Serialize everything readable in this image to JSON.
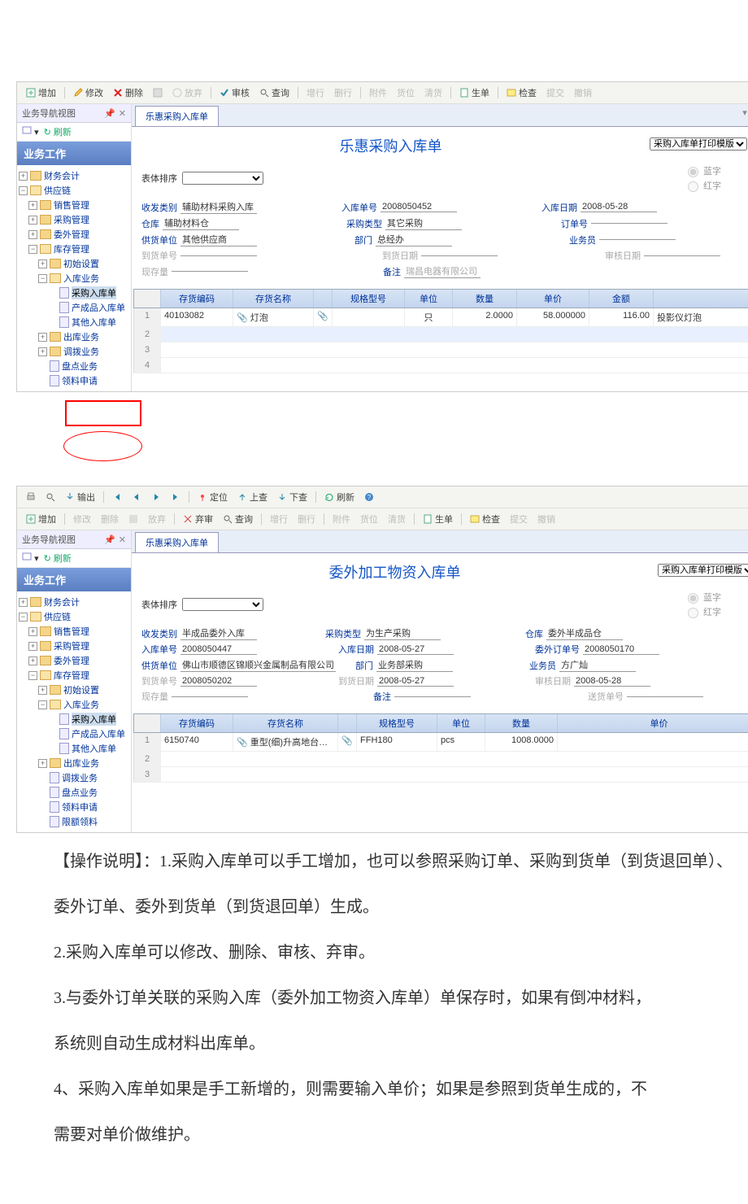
{
  "toolbar": {
    "add": "增加",
    "edit": "修改",
    "delete": "删除",
    "undo": "",
    "abandon": "放弃",
    "audit": "审核",
    "unaudit": "弃审",
    "query": "查询",
    "addrow": "增行",
    "delrow": "删行",
    "attach": "附件",
    "locate": "货位",
    "clear": "清货",
    "bill": "生单",
    "check": "检查",
    "submit": "提交",
    "revoke": "撤销",
    "output": "输出",
    "first": "",
    "prev": "",
    "next": "",
    "last": "",
    "position": "定位",
    "upquery": "上查",
    "downquery": "下查",
    "refresh": "刷新"
  },
  "sidebar": {
    "title": "业务导航视图",
    "close_x": "✕",
    "dropdown": "▾",
    "refresh": "刷新",
    "header": "业务工作",
    "nodes": {
      "n0": "财务会计",
      "n1": "供应链",
      "n2": "销售管理",
      "n3": "采购管理",
      "n4": "委外管理",
      "n5": "库存管理",
      "n6": "初始设置",
      "n7": "入库业务",
      "n8": "采购入库单",
      "n9": "产成品入库单",
      "n10": "其他入库单",
      "n11": "出库业务",
      "n12": "调拨业务",
      "n13": "盘点业务",
      "n14": "领料申请",
      "n15": "限额领料"
    }
  },
  "doc1": {
    "tab": "乐惠采购入库单",
    "title": "乐惠采购入库单",
    "radio_blue": "蓝字",
    "radio_red": "红字",
    "print_template": "采购入库单打印模版",
    "sort_label": "表体排序",
    "fields": {
      "f1l": "收发类别",
      "f1v": "辅助材料采购入库",
      "f2l": "入库单号",
      "f2v": "2008050452",
      "f3l": "入库日期",
      "f3v": "2008-05-28",
      "f4l": "仓库",
      "f4v": "辅助材料仓",
      "f5l": "采购类型",
      "f5v": "其它采购",
      "f6l": "订单号",
      "f6v": "",
      "f7l": "供货单位",
      "f7v": "其他供应商",
      "f8l": "部门",
      "f8v": "总经办",
      "f9l": "业务员",
      "f9v": "",
      "f10l": "到货单号",
      "f10v": "",
      "f11l": "到货日期",
      "f11v": "",
      "f12l": "审核日期",
      "f12v": "",
      "f13l": "现存量",
      "f13v": "",
      "f14l": "备注",
      "f14v": "瑞昌电器有限公司"
    },
    "grid": {
      "headers": [
        "",
        "存货编码",
        "存货名称",
        "",
        "规格型号",
        "单位",
        "数量",
        "单价",
        "金额",
        ""
      ],
      "row1": {
        "code": "40103082",
        "name": "灯泡",
        "spec": "",
        "unit": "只",
        "qty": "2.0000",
        "price": "58.000000",
        "amount": "116.00",
        "note": "投影仪灯泡"
      }
    }
  },
  "doc2": {
    "tab": "乐惠采购入库单",
    "title": "委外加工物资入库单",
    "print_template": "采购入库单打印模版",
    "sort_label": "表体排序",
    "radio_blue": "蓝字",
    "radio_red": "红字",
    "fields": {
      "f1l": "收发类别",
      "f1v": "半成品委外入库",
      "f2l": "采购类型",
      "f2v": "为生产采购",
      "f3l": "仓库",
      "f3v": "委外半成品仓",
      "f4l": "入库单号",
      "f4v": "2008050447",
      "f5l": "入库日期",
      "f5v": "2008-05-27",
      "f6l": "委外订单号",
      "f6v": "2008050170",
      "f7l": "供货单位",
      "f7v": "佛山市顺德区锦顺兴金属制品有限公司",
      "f8l": "部门",
      "f8v": "业务部采购",
      "f9l": "业务员",
      "f9v": "方广灿",
      "f10l": "到货单号",
      "f10v": "2008050202",
      "f11l": "到货日期",
      "f11v": "2008-05-27",
      "f12l": "审核日期",
      "f12v": "2008-05-28",
      "f13l": "现存量",
      "f13v": "",
      "f14l": "备注",
      "f14v": "",
      "f15l": "送货单号",
      "f15v": ""
    },
    "grid": {
      "headers": [
        "",
        "存货编码",
        "存货名称",
        "",
        "规格型号",
        "单位",
        "数量",
        "单价"
      ],
      "row1": {
        "code": "6150740",
        "name": "重型(细)升高地台…",
        "spec": "FFH180",
        "unit": "pcs",
        "qty": "1008.0000",
        "price": ""
      }
    }
  },
  "text": {
    "p1": "【操作说明】：1.采购入库单可以手工增加，也可以参照采购订单、采购到货单（到货退回单）、",
    "p2": "委外订单、委外到货单（到货退回单）生成。",
    "p3": "2.采购入库单可以修改、删除、审核、弃审。",
    "p4": "3.与委外订单关联的采购入库（委外加工物资入库单）单保存时，如果有倒冲材料，",
    "p5": "系统则自动生成材料出库单。",
    "p6": "4、采购入库单如果是手工新增的，则需要输入单价；如果是参照到货单生成的，不",
    "p7": "需要对单价做维护。"
  }
}
